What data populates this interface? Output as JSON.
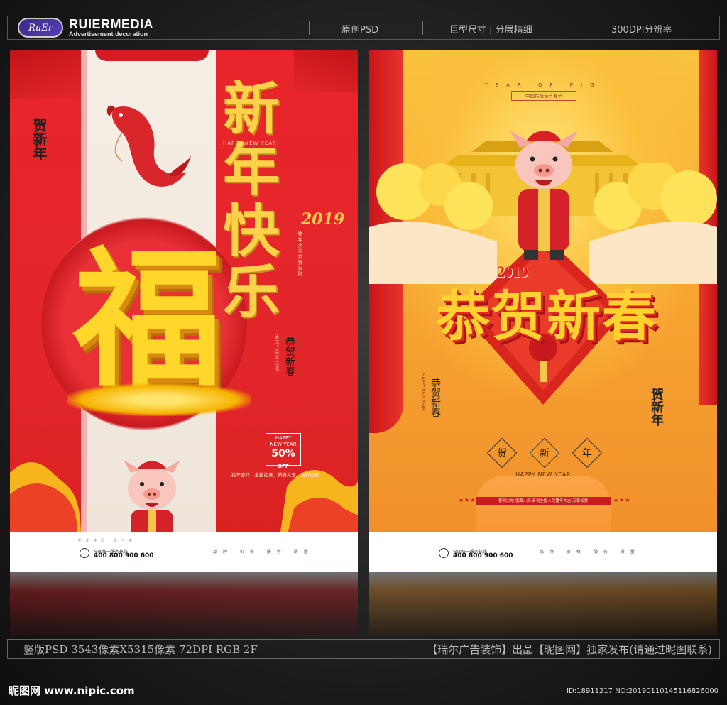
{
  "header": {
    "logo_text": "RuEr",
    "brand_name": "RUIERMEDIA",
    "brand_subtitle": "Advertisement decoration",
    "items": [
      "原创PSD",
      "巨型尺寸 | 分层精细",
      "300DPI分辨率"
    ]
  },
  "left_poster": {
    "fu": "福",
    "calligraphy": "新年快乐",
    "happy_new_year": "HAPPY NEW YEAR",
    "year": "2019",
    "wish_small": "猪年大吉恭贺发财",
    "vertical_left": "贺新年",
    "vertical_right": "恭贺新春",
    "vertical_small": "HAPPY NEW YEAR",
    "badge_line1": "HAPPY",
    "badge_line2": "NEW YEAR",
    "badge_pct": "50%",
    "badge_off": "OFF",
    "note": "猪年吉祥、全猪如意、新春大吉、吉祥如意",
    "footer_dots": "新 年 快 乐 · 福 气 来",
    "footer_label": "全国统一服务热线",
    "footer_number": "400 800 900 600",
    "footer_cols": "品牌 价格 服务 质量"
  },
  "right_poster": {
    "year_of_pig": "YEAR OF PIG",
    "tag": "中国传统佳节春节",
    "year": "2019",
    "title": "恭贺新春",
    "vertical_left": "恭贺新春",
    "vertical_left_small": "HAPPY NEW YEAR",
    "vertical_right": "贺新年",
    "seal": [
      "贺",
      "新",
      "年"
    ],
    "happy_new_year": "HAPPY NEW YEAR",
    "ribbon": "春回大地 福满人间 恭祝全国人民猪年大吉 万事如意",
    "ribbon_l": "★★★",
    "ribbon_r": "★★★",
    "footer_label": "全国统一服务热线",
    "footer_number": "400 800 900 600",
    "footer_cols": "品牌 价格 服务 质量"
  },
  "footer": {
    "info_left": "竖版PSD 3543像素X5315像素 72DPI RGB 2F",
    "info_right": "【瑞尔广告装饰】出品【昵图网】独家发布(请通过昵图联系)",
    "watermark": "昵图网 www.nipic.com",
    "id_text": "ID:18911217 NO:20190110145116826000"
  },
  "colors": {
    "left_bg": "#e3262a",
    "right_bg": "#f7a532",
    "gold": "#ffd230"
  }
}
